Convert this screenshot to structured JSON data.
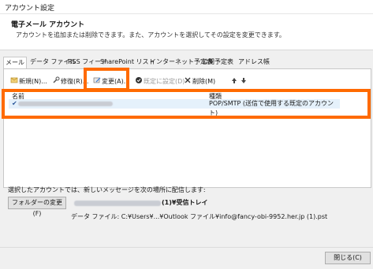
{
  "window": {
    "title": "アカウント設定"
  },
  "header": {
    "title": "電子メール アカウント",
    "subtitle": "アカウントを追加または削除できます。また、アカウントを選択してその設定を変更できます。"
  },
  "tabs": [
    {
      "label": "メール",
      "active": true
    },
    {
      "label": "データ ファイル"
    },
    {
      "label": "RSS フィード"
    },
    {
      "label": "SharePoint リスト"
    },
    {
      "label": "インターネット予定表"
    },
    {
      "label": "公開予定表"
    },
    {
      "label": "アドレス帳"
    }
  ],
  "toolbar": {
    "new_label": "新規(N)...",
    "repair_label": "修復(R)...",
    "change_label": "変更(A)...",
    "default_label": "既定に設定(D)",
    "delete_label": "削除(M)"
  },
  "accounts": {
    "col_name": "名前",
    "col_type": "種類",
    "rows": [
      {
        "type": "POP/SMTP (送信で使用する既定のアカウント)"
      }
    ]
  },
  "delivery": {
    "label": "選択したアカウントでは、新しいメッセージを次の場所に配信します:",
    "change_folder_button": "フォルダーの変更(F)",
    "folder_suffix": "(1)¥受信トレイ",
    "data_file": "データ ファイル: C:¥Users¥...¥Outlook ファイル¥info@fancy-obi-9952.her.jp (1).pst"
  },
  "footer": {
    "close_button": "閉じる(C)"
  },
  "colors": {
    "highlight": "#ff6a00",
    "selection": "#e5f1fb"
  }
}
